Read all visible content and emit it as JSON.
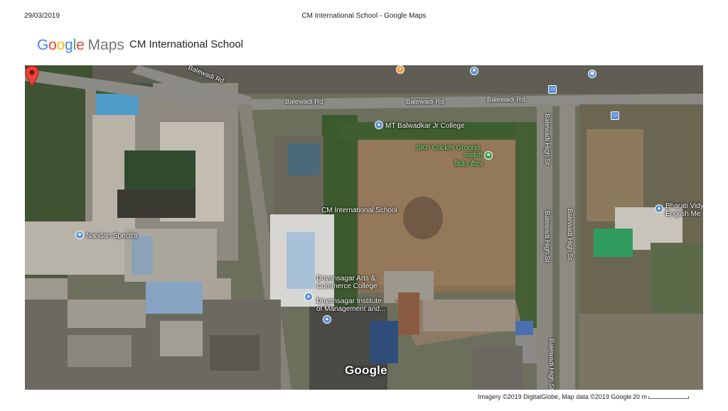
{
  "print_header": {
    "date": "29/03/2019",
    "title": "CM International School - Google Maps"
  },
  "brand": {
    "logo_letters": [
      {
        "char": "G",
        "color": "#4285F4"
      },
      {
        "char": "o",
        "color": "#EA4335"
      },
      {
        "char": "o",
        "color": "#FBBC05"
      },
      {
        "char": "g",
        "color": "#4285F4"
      },
      {
        "char": "l",
        "color": "#34A853"
      },
      {
        "char": "e",
        "color": "#EA4335"
      }
    ],
    "product": "Maps"
  },
  "place": {
    "title": "CM International School",
    "pin_color": "#EA4335"
  },
  "map": {
    "mode": "satellite",
    "roads": {
      "balewadi_rd_1": "Balewadi Rd",
      "balewadi_rd_2": "Balewadi Rd",
      "balewadi_rd_3": "Balewadi Rd",
      "balewadi_rd_4": "Balewadi Rd",
      "balewadi_high_st_1": "Balewadi High St",
      "balewadi_high_st_2": "Balewadi High St",
      "balewadi_high_st_3": "Balewadi High St",
      "balewadi_high_st_4": "Balewadi High St"
    },
    "places": {
      "mt_college": "MT Balwadkar Jr College",
      "cricket_ground": "SKP Cricket Ground",
      "cricket_ground_local_1": "एसकेपी",
      "cricket_ground_local_2": "क्रिकेट मैदान",
      "school": "CM International School",
      "nandan": "Nandan Spectra",
      "dnyansagar_arts_1": "Dnyansagar Arts &",
      "dnyansagar_arts_2": "Commerce College",
      "dnyansagar_inst_1": "Dnyansagar Institute",
      "dnyansagar_inst_2": "of Management and...",
      "bharati_1": "Bharati Vidy",
      "bharati_2": "English Me"
    },
    "watermark": "Google"
  },
  "footer": {
    "attribution": "Imagery ©2019 DigitalGlobe, Map data ©2019 Google",
    "scale": "20 m"
  }
}
